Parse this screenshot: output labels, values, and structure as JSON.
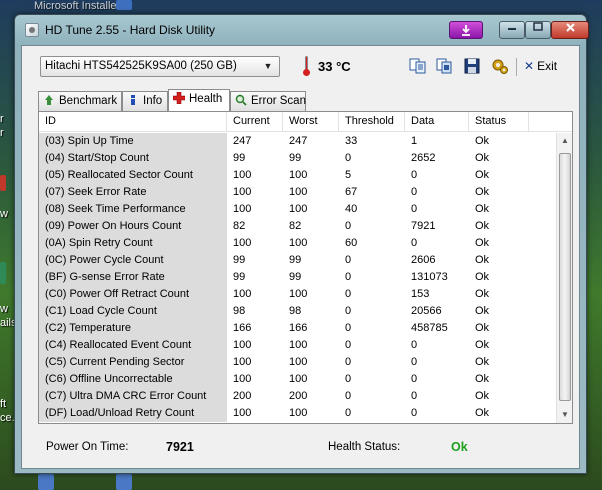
{
  "desktop": {
    "top_fragment": "Microsoft Installer",
    "fragments": [
      "r",
      "r",
      "w",
      "w",
      "ails",
      "ft",
      "ce..."
    ]
  },
  "window": {
    "title": "HD Tune 2.55 - Hard Disk Utility",
    "controls": {
      "help": "",
      "minimize": "",
      "maximize": "",
      "close": ""
    }
  },
  "toolbar": {
    "drive": "Hitachi HTS542525K9SA00 (250 GB)",
    "temperature": "33 °C",
    "exit_label": "Exit"
  },
  "tabs": [
    {
      "label": "Benchmark",
      "icon": "benchmark-icon"
    },
    {
      "label": "Info",
      "icon": "info-icon"
    },
    {
      "label": "Health",
      "icon": "health-icon",
      "active": true
    },
    {
      "label": "Error Scan",
      "icon": "error-scan-icon"
    }
  ],
  "table": {
    "headers": [
      "ID",
      "Current",
      "Worst",
      "Threshold",
      "Data",
      "Status"
    ],
    "rows": [
      [
        "(03) Spin Up Time",
        "247",
        "247",
        "33",
        "1",
        "Ok"
      ],
      [
        "(04) Start/Stop Count",
        "99",
        "99",
        "0",
        "2652",
        "Ok"
      ],
      [
        "(05) Reallocated Sector Count",
        "100",
        "100",
        "5",
        "0",
        "Ok"
      ],
      [
        "(07) Seek Error Rate",
        "100",
        "100",
        "67",
        "0",
        "Ok"
      ],
      [
        "(08) Seek Time Performance",
        "100",
        "100",
        "40",
        "0",
        "Ok"
      ],
      [
        "(09) Power On Hours Count",
        "82",
        "82",
        "0",
        "7921",
        "Ok"
      ],
      [
        "(0A) Spin Retry Count",
        "100",
        "100",
        "60",
        "0",
        "Ok"
      ],
      [
        "(0C) Power Cycle Count",
        "99",
        "99",
        "0",
        "2606",
        "Ok"
      ],
      [
        "(BF) G-sense Error Rate",
        "99",
        "99",
        "0",
        "131073",
        "Ok"
      ],
      [
        "(C0) Power Off Retract Count",
        "100",
        "100",
        "0",
        "153",
        "Ok"
      ],
      [
        "(C1) Load Cycle Count",
        "98",
        "98",
        "0",
        "20566",
        "Ok"
      ],
      [
        "(C2) Temperature",
        "166",
        "166",
        "0",
        "458785",
        "Ok"
      ],
      [
        "(C4) Reallocated Event Count",
        "100",
        "100",
        "0",
        "0",
        "Ok"
      ],
      [
        "(C5) Current Pending Sector",
        "100",
        "100",
        "0",
        "0",
        "Ok"
      ],
      [
        "(C6) Offline Uncorrectable",
        "100",
        "100",
        "0",
        "0",
        "Ok"
      ],
      [
        "(C7) Ultra DMA CRC Error Count",
        "200",
        "200",
        "0",
        "0",
        "Ok"
      ],
      [
        "(DF) Load/Unload Retry Count",
        "100",
        "100",
        "0",
        "0",
        "Ok"
      ]
    ]
  },
  "status": {
    "power_on_label": "Power On Time:",
    "power_on_value": "7921",
    "health_label": "Health Status:",
    "health_value": "Ok"
  }
}
